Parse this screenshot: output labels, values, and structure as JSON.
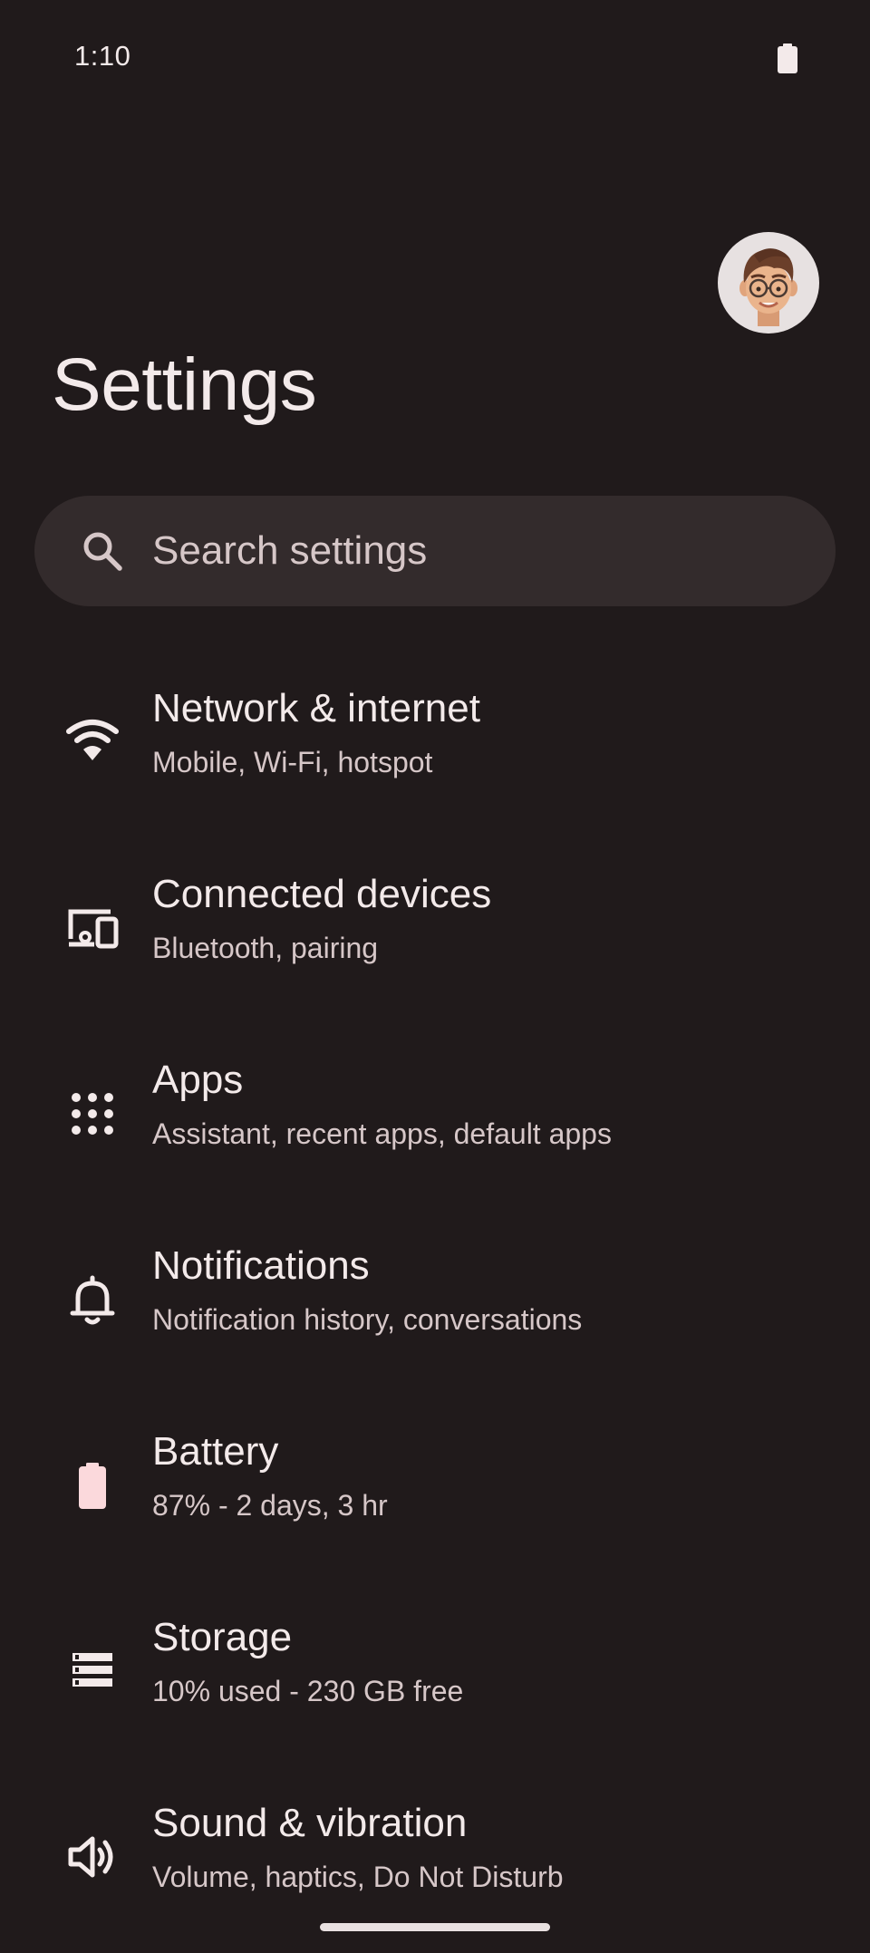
{
  "status_bar": {
    "time": "1:10",
    "battery_icon": "battery-full-icon"
  },
  "header": {
    "title": "Settings",
    "avatar": "memoji-avatar"
  },
  "search": {
    "placeholder": "Search settings",
    "icon": "search-icon"
  },
  "items": [
    {
      "title": "Network & internet",
      "subtitle": "Mobile, Wi-Fi, hotspot",
      "icon": "wifi-icon"
    },
    {
      "title": "Connected devices",
      "subtitle": "Bluetooth, pairing",
      "icon": "devices-icon"
    },
    {
      "title": "Apps",
      "subtitle": "Assistant, recent apps, default apps",
      "icon": "apps-grid-icon"
    },
    {
      "title": "Notifications",
      "subtitle": "Notification history, conversations",
      "icon": "bell-icon"
    },
    {
      "title": "Battery",
      "subtitle": "87% - 2 days, 3 hr",
      "icon": "battery-icon"
    },
    {
      "title": "Storage",
      "subtitle": "10% used - 230 GB free",
      "icon": "storage-icon"
    },
    {
      "title": "Sound & vibration",
      "subtitle": "Volume, haptics, Do Not Disturb",
      "icon": "volume-icon"
    }
  ],
  "colors": {
    "background": "#201a1b",
    "search_background": "#332b2c",
    "title_text": "#f3eaea",
    "subtitle_text": "#d6c7c8"
  }
}
